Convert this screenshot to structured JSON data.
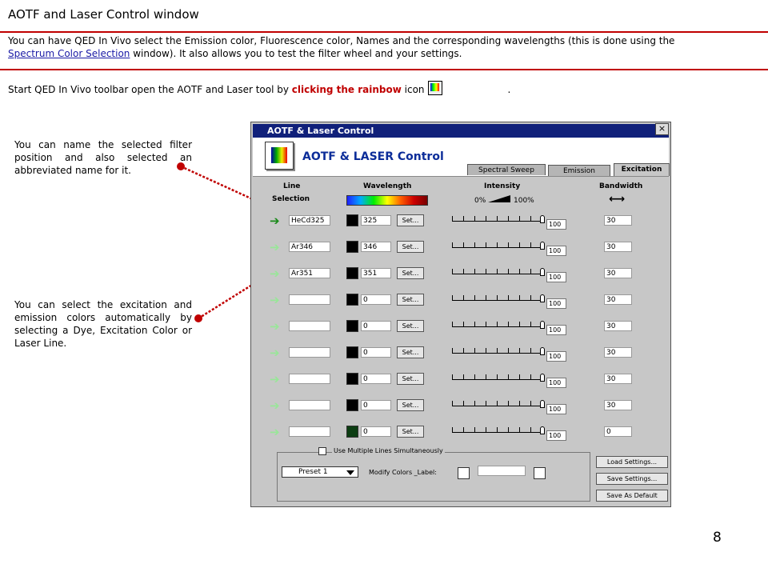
{
  "page": {
    "title": "AOTF and Laser Control window",
    "intro_before_link": "You can have QED In Vivo select the Emission color, Fluorescence color, Names and the corresponding wavelengths (this is done using the ",
    "intro_link": "Spectrum Color Selection",
    "intro_after_link": " window).  It also allows you to test the filter wheel and your settings.",
    "start_before": "Start QED In Vivo toolbar open the AOTF and Laser tool by ",
    "start_emphasis": "clicking the rainbow",
    "start_after": " icon",
    "start_end": ".",
    "note_name": "You can name the selected filter position and also selected an abbreviated name for it.",
    "note_excitation": "You can select the excitation and emission colors automatically by selecting a Dye, Excitation Color or Laser Line.",
    "page_number": "8",
    "accent_color": "#c00000"
  },
  "window": {
    "title": "AOTF & Laser Control",
    "close": "×",
    "app_title": "AOTF & LASER Control",
    "tabs": [
      "Spectral Sweep",
      "Emission",
      "Excitation"
    ],
    "active_tab": "Excitation",
    "col_line": "Line",
    "col_selection": "Selection",
    "col_wavelength": "Wavelength",
    "col_intensity": "Intensity",
    "intensity_min": "0%",
    "intensity_max": "100%",
    "col_bandwidth": "Bandwidth",
    "set_label": "Set...",
    "rows": [
      {
        "name": "HeCd325",
        "wavelength": "325",
        "intensity": "100",
        "bandwidth": "30",
        "selected": true,
        "swatch": "#000000"
      },
      {
        "name": "Ar346",
        "wavelength": "346",
        "intensity": "100",
        "bandwidth": "30",
        "selected": false,
        "swatch": "#000000"
      },
      {
        "name": "Ar351",
        "wavelength": "351",
        "intensity": "100",
        "bandwidth": "30",
        "selected": false,
        "swatch": "#000000"
      },
      {
        "name": "",
        "wavelength": "0",
        "intensity": "100",
        "bandwidth": "30",
        "selected": false,
        "swatch": "#000000"
      },
      {
        "name": "",
        "wavelength": "0",
        "intensity": "100",
        "bandwidth": "30",
        "selected": false,
        "swatch": "#000000"
      },
      {
        "name": "",
        "wavelength": "0",
        "intensity": "100",
        "bandwidth": "30",
        "selected": false,
        "swatch": "#000000"
      },
      {
        "name": "",
        "wavelength": "0",
        "intensity": "100",
        "bandwidth": "30",
        "selected": false,
        "swatch": "#000000"
      },
      {
        "name": "",
        "wavelength": "0",
        "intensity": "100",
        "bandwidth": "30",
        "selected": false,
        "swatch": "#000000"
      },
      {
        "name": "",
        "wavelength": "0",
        "intensity": "100",
        "bandwidth": "0",
        "selected": false,
        "swatch": "#0c3d12"
      }
    ],
    "multi_lines_label": "Use Multiple Lines Simultaneously",
    "preset_value": "Preset 1",
    "modify_label": "Modify Colors _Label:",
    "load_settings": "Load Settings...",
    "save_settings": "Save Settings...",
    "save_default": "Save As Default",
    "arrow_selected_color": "#1a8a1a",
    "arrow_unselected_color": "#99e699"
  }
}
